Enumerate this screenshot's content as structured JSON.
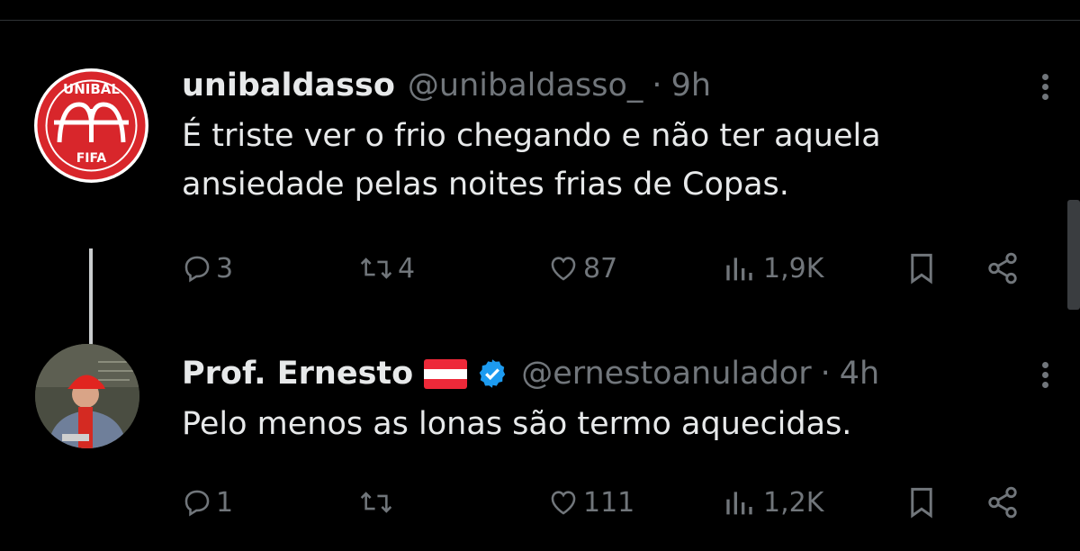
{
  "colors": {
    "background": "#000000",
    "text": "#e7e9ea",
    "muted": "#71767b",
    "verified": "#1d9bf0",
    "avatar_red": "#d8262b"
  },
  "tweets": [
    {
      "avatar_text_top": "UNIBAL",
      "avatar_text_bottom": "FIFA",
      "name": "unibaldasso",
      "handle": "@unibaldasso_",
      "dot": "·",
      "time": "9h",
      "text": "É triste ver o frio chegando e não ter aquela ansiedade pelas noites frias de Copas.",
      "replies": "3",
      "retweets": "4",
      "likes": "87",
      "views": "1,9K"
    },
    {
      "name": "Prof. Ernesto",
      "flag": "austria-flag",
      "verified": "verified-badge",
      "handle": "@ernestoanulador",
      "dot": "·",
      "time": "4h",
      "text": "Pelo menos as lonas são termo aquecidas.",
      "replies": "1",
      "retweets": "",
      "likes": "111",
      "views": "1,2K"
    }
  ]
}
